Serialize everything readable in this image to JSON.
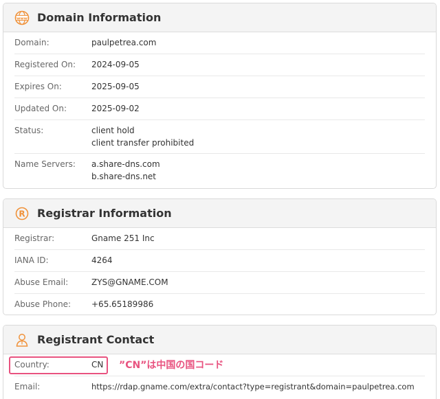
{
  "domain_info": {
    "title": "Domain Information",
    "icon": "www-globe-icon",
    "rows": [
      {
        "label": "Domain:",
        "values": [
          "paulpetrea.com"
        ]
      },
      {
        "label": "Registered On:",
        "values": [
          "2024-09-05"
        ]
      },
      {
        "label": "Expires On:",
        "values": [
          "2025-09-05"
        ]
      },
      {
        "label": "Updated On:",
        "values": [
          "2025-09-02"
        ]
      },
      {
        "label": "Status:",
        "values": [
          "client hold",
          "client transfer prohibited"
        ]
      },
      {
        "label": "Name Servers:",
        "values": [
          "a.share-dns.com",
          "b.share-dns.net"
        ]
      }
    ]
  },
  "registrar_info": {
    "title": "Registrar Information",
    "icon": "registered-icon",
    "rows": [
      {
        "label": "Registrar:",
        "value": "Gname 251 Inc"
      },
      {
        "label": "IANA ID:",
        "value": "4264"
      },
      {
        "label": "Abuse Email:",
        "value": "ZYS@GNAME.COM"
      },
      {
        "label": "Abuse Phone:",
        "value": "+65.65189986"
      }
    ]
  },
  "registrant_contact": {
    "title": "Registrant Contact",
    "icon": "person-icon",
    "rows": [
      {
        "label": "Country:",
        "value": "CN"
      },
      {
        "label": "Email:",
        "value": "https://rdap.gname.com/extra/contact?type=registrant&domain=paulpetrea.com"
      }
    ]
  },
  "annotation": {
    "text": "”CN”は中国の国コード",
    "color": "#e8527f"
  },
  "colors": {
    "accent_orange": "#f0923a",
    "annotation_pink": "#e8527f"
  }
}
